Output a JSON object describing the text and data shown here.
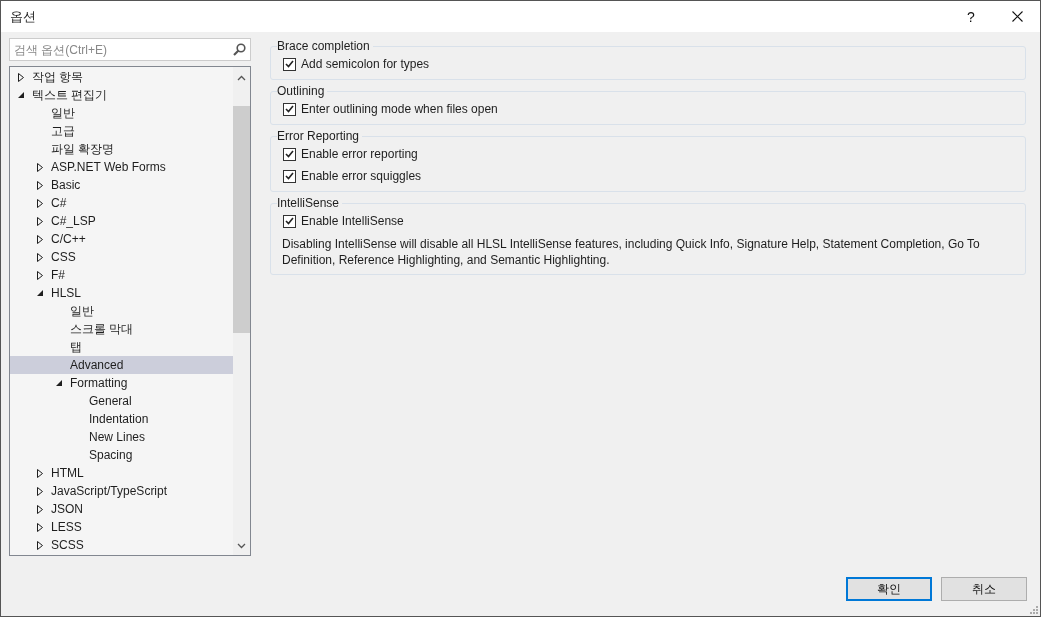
{
  "window": {
    "title": "옵션",
    "help": "?"
  },
  "search": {
    "placeholder": "검색 옵션(Ctrl+E)"
  },
  "tree": [
    {
      "label": "작업 항목",
      "expanded": false,
      "selected": false
    },
    {
      "label": "텍스트 편집기",
      "expanded": true,
      "selected": false,
      "children": [
        {
          "label": "일반",
          "selected": false
        },
        {
          "label": "고급",
          "selected": false
        },
        {
          "label": "파일 확장명",
          "selected": false
        },
        {
          "label": "ASP.NET Web Forms",
          "expanded": false,
          "selected": false
        },
        {
          "label": "Basic",
          "expanded": false,
          "selected": false
        },
        {
          "label": "C#",
          "expanded": false,
          "selected": false
        },
        {
          "label": "C#_LSP",
          "expanded": false,
          "selected": false
        },
        {
          "label": "C/C++",
          "expanded": false,
          "selected": false
        },
        {
          "label": "CSS",
          "expanded": false,
          "selected": false
        },
        {
          "label": "F#",
          "expanded": false,
          "selected": false
        },
        {
          "label": "HLSL",
          "expanded": true,
          "selected": false,
          "children": [
            {
              "label": "일반",
              "selected": false
            },
            {
              "label": "스크롤 막대",
              "selected": false
            },
            {
              "label": "탭",
              "selected": false
            },
            {
              "label": "Advanced",
              "selected": true
            },
            {
              "label": "Formatting",
              "expanded": true,
              "selected": false,
              "children": [
                {
                  "label": "General",
                  "selected": false
                },
                {
                  "label": "Indentation",
                  "selected": false
                },
                {
                  "label": "New Lines",
                  "selected": false
                },
                {
                  "label": "Spacing",
                  "selected": false
                }
              ]
            }
          ]
        },
        {
          "label": "HTML",
          "expanded": false,
          "selected": false
        },
        {
          "label": "JavaScript/TypeScript",
          "expanded": false,
          "selected": false
        },
        {
          "label": "JSON",
          "expanded": false,
          "selected": false
        },
        {
          "label": "LESS",
          "expanded": false,
          "selected": false
        },
        {
          "label": "SCSS",
          "expanded": false,
          "selected": false
        }
      ]
    }
  ],
  "groups": [
    {
      "title": "Brace completion",
      "options": [
        {
          "label": "Add semicolon for types",
          "checked": true
        }
      ]
    },
    {
      "title": "Outlining",
      "options": [
        {
          "label": "Enter outlining mode when files open",
          "checked": true
        }
      ]
    },
    {
      "title": "Error Reporting",
      "options": [
        {
          "label": "Enable error reporting",
          "checked": true
        },
        {
          "label": "Enable error squiggles",
          "checked": true
        }
      ]
    },
    {
      "title": "IntelliSense",
      "options": [
        {
          "label": "Enable IntelliSense",
          "checked": true
        }
      ],
      "note": "Disabling IntelliSense will disable all HLSL IntelliSense features, including Quick Info, Signature Help, Statement Completion, Go To Definition, Reference Highlighting, and Semantic Highlighting."
    }
  ],
  "buttons": [
    {
      "label": "확인",
      "default": true
    },
    {
      "label": "취소",
      "default": false
    }
  ]
}
